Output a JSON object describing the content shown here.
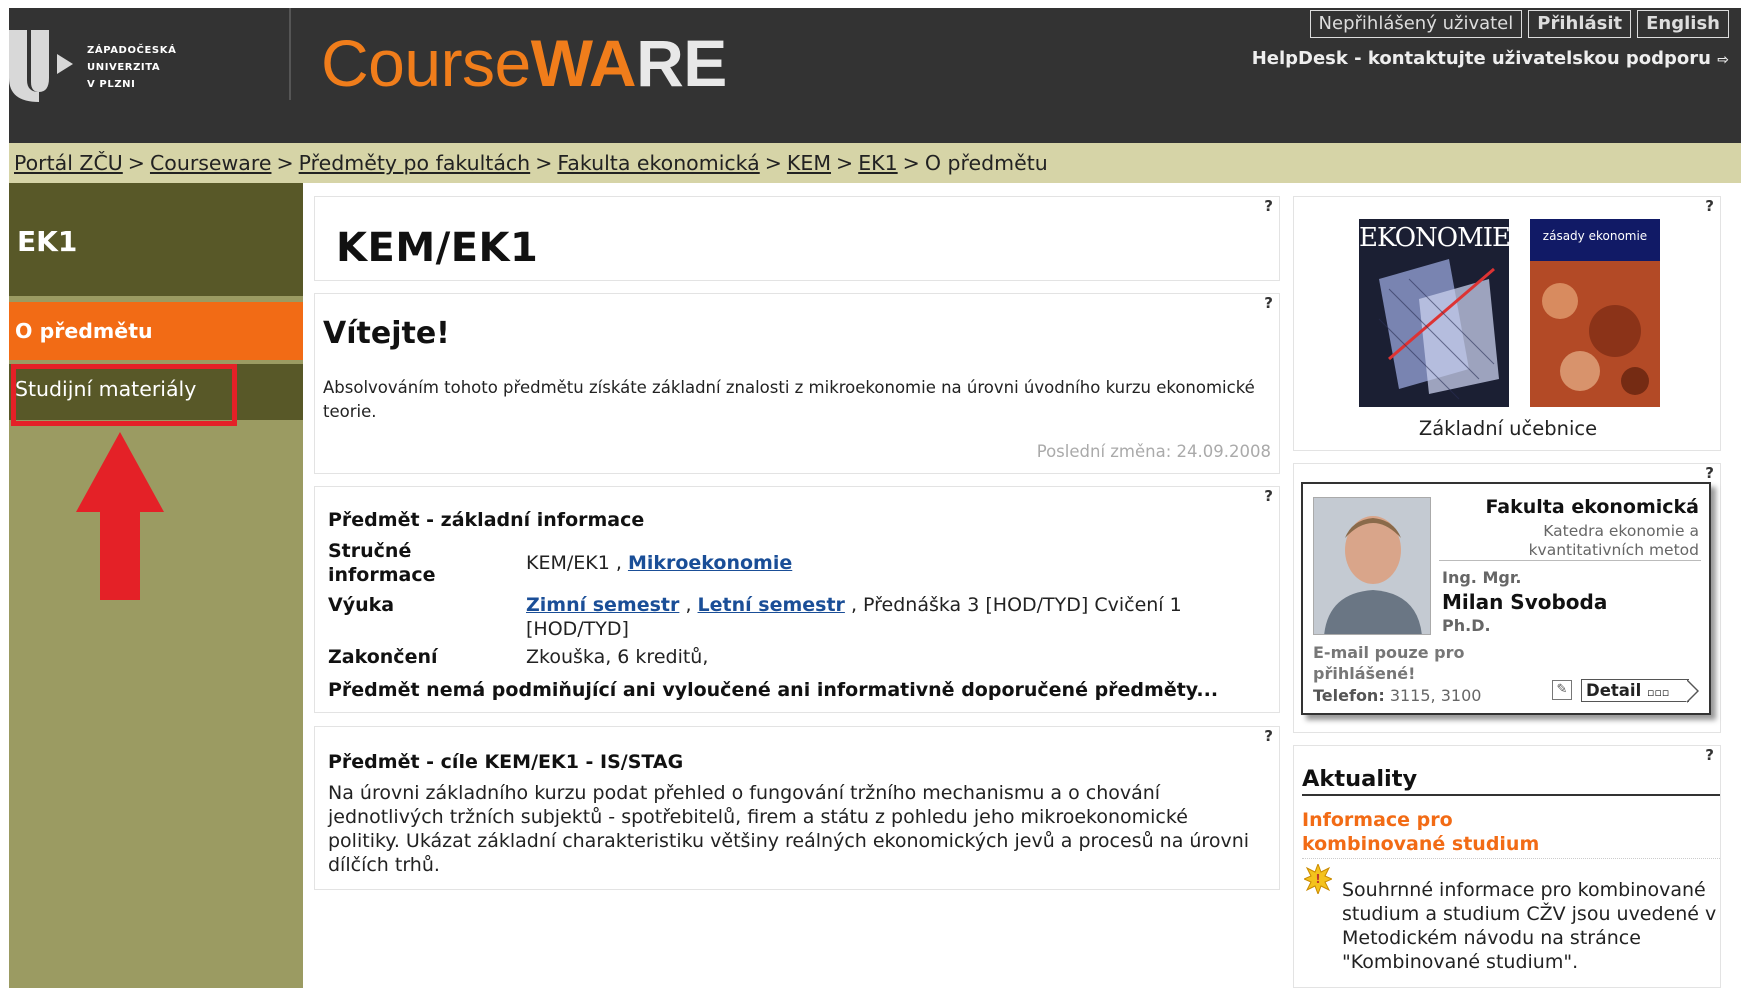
{
  "header": {
    "logo_lines": [
      "ZÁPADOČESKÁ",
      "UNIVERZITA",
      "V PLZNI"
    ],
    "app_title_part1": "Course",
    "app_title_part2": "WA",
    "app_title_part3": "RE",
    "user_status": "Nepřihlášený uživatel",
    "login_label": "Přihlásit",
    "lang_label": "English",
    "helpdesk_label": "HelpDesk - kontaktujte uživatelskou podporu"
  },
  "breadcrumb": {
    "items": [
      "Portál ZČU",
      "Courseware",
      "Předměty po fakultách",
      "Fakulta ekonomická",
      "KEM",
      "EK1"
    ],
    "current": "O předmětu",
    "separator": ">"
  },
  "sidebar": {
    "title": "EK1",
    "items": [
      {
        "label": "O předmětu",
        "active": true
      },
      {
        "label": "Studijní materiály",
        "active": false
      }
    ],
    "annotation_color": "#e42127"
  },
  "help_mark": "?",
  "course": {
    "code": "KEM/EK1"
  },
  "welcome": {
    "heading": "Vítejte!",
    "text": "Absolvováním tohoto předmětu získáte základní znalosti z mikroekonomie na úrovni úvodního kurzu ekonomické teorie.",
    "last_change": "Poslední změna: 24.09.2008"
  },
  "info": {
    "heading": "Předmět - základní informace",
    "brief_label": "Stručné informace",
    "brief_code": "KEM/EK1 ,",
    "brief_name": "Mikroekonomie",
    "teaching_label": "Výuka",
    "winter": "Zimní semestr",
    "comma": ",",
    "summer": "Letní semestr",
    "teaching_rest": ", Přednáška 3 [HOD/TYD] Cvičení 1 [HOD/TYD]",
    "completion_label": "Zakončení",
    "completion_value": "Zkouška, 6 kreditů,",
    "prerequisites": "Předmět nemá podmiňující ani vyloučené ani informativně doporučené předměty..."
  },
  "goals": {
    "heading": "Předmět - cíle KEM/EK1 - IS/STAG",
    "text": "Na úrovni základního kurzu podat přehled o fungování tržního mechanismu a o chování jednotlivých tržních subjektů - spotřebitelů, firem a státu z pohledu jeho mikroekonomické politiky. Ukázat základní charakteristiku většiny reálných ekonomických jevů a procesů na úrovni dílčích trhů."
  },
  "books": {
    "book1_title": "EKONOMIE",
    "book2_title": "zásady ekonomie",
    "caption": "Základní učebnice"
  },
  "teacher": {
    "faculty": "Fakulta ekonomická",
    "department": "Katedra ekonomie a kvantitativních metod",
    "title_before": "Ing. Mgr.",
    "name": "Milan Svoboda",
    "title_after": "Ph.D.",
    "email_note": "E-mail pouze pro přihlášené!",
    "phone_label": "Telefon:",
    "phone_value": "3115, 3100",
    "detail_label": "Detail"
  },
  "news": {
    "heading": "Aktuality",
    "link": "Informace pro kombinované studium",
    "text": "Souhrnné informace pro kombinované studium  a studium CŽV jsou uvedené v Metodickém návodu na stránce \"Kombinované studium\"."
  },
  "colors": {
    "header_bg": "#333333",
    "accent_orange": "#f26b15",
    "breadcrumb_bg": "#d6d4a7",
    "sidebar_bg": "#9b9b62",
    "sidebar_dark": "#585828",
    "link_blue": "#1a4e97"
  }
}
